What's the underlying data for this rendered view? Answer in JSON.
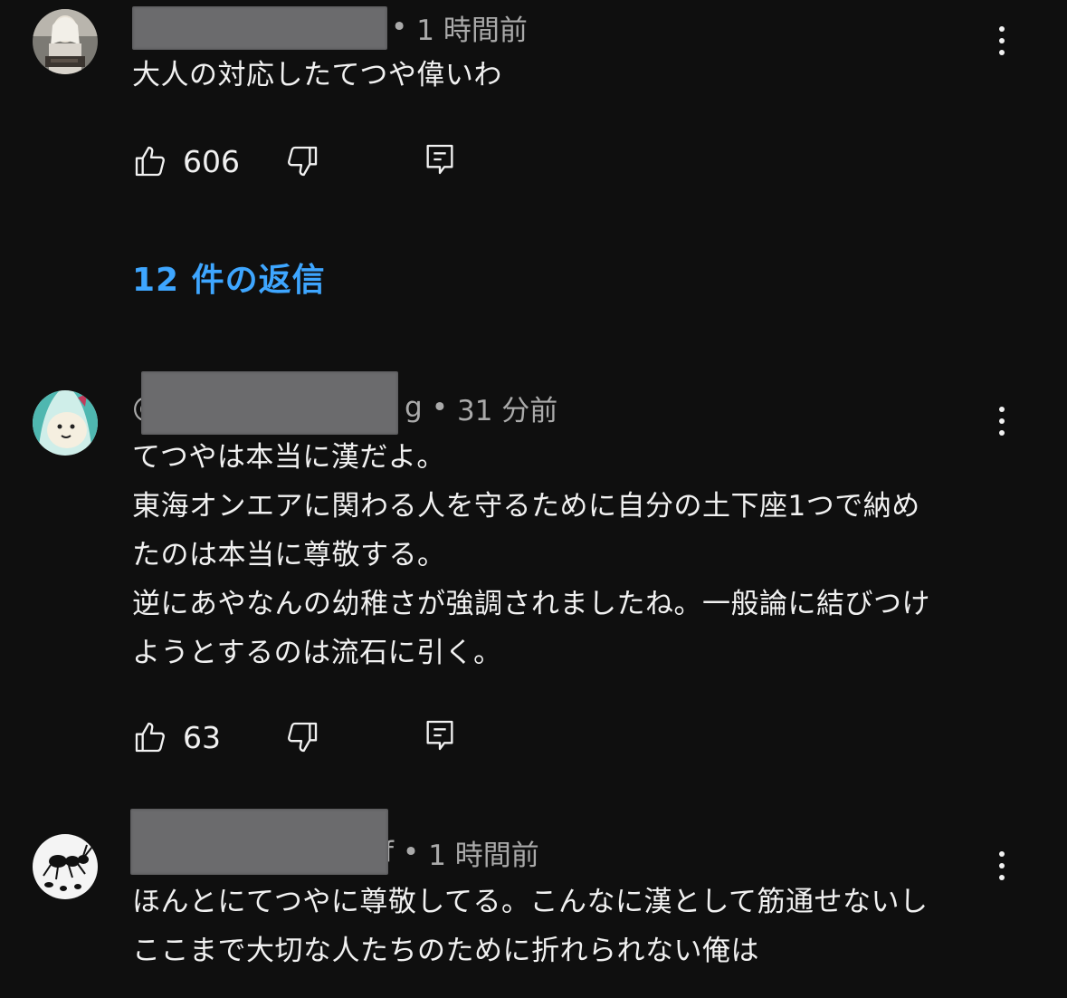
{
  "colors": {
    "background": "#0f0f0f",
    "text": "#f1f1f1",
    "secondary": "#aaaaaa",
    "link": "#3ea6ff"
  },
  "comments": [
    {
      "handle_visible": "",
      "separator": "•",
      "time": "1 時間前",
      "text": "大人の対応したてつや偉いわ",
      "likes": "606",
      "avatar_icon": "user-avatar-photo"
    },
    {
      "handle_visible_start": "@",
      "handle_visible_end": "g",
      "separator": "•",
      "time": "31 分前",
      "text": "てつやは本当に漢だよ。\n東海オンエアに関わる人を守るために自分の土下座1つで納め\nたのは本当に尊敬する。\n逆にあやなんの幼稚さが強調されましたね。一般論に結びつけ\nようとするのは流石に引く。",
      "likes": "63",
      "avatar_icon": "anime-character-avatar"
    },
    {
      "handle_visible_end": "f",
      "separator": "•",
      "time": "1 時間前",
      "text": "ほんとにてつやに尊敬してる。こんなに漢として筋通せないし\nここまで大切な人たちのために折れられない俺は",
      "avatar_icon": "ant-avatar"
    }
  ],
  "replies": {
    "label": "12 件の返信"
  },
  "icons": {
    "like": "thumbs-up-icon",
    "dislike": "thumbs-down-icon",
    "reply": "reply-comment-icon",
    "more": "more-vertical-icon"
  }
}
